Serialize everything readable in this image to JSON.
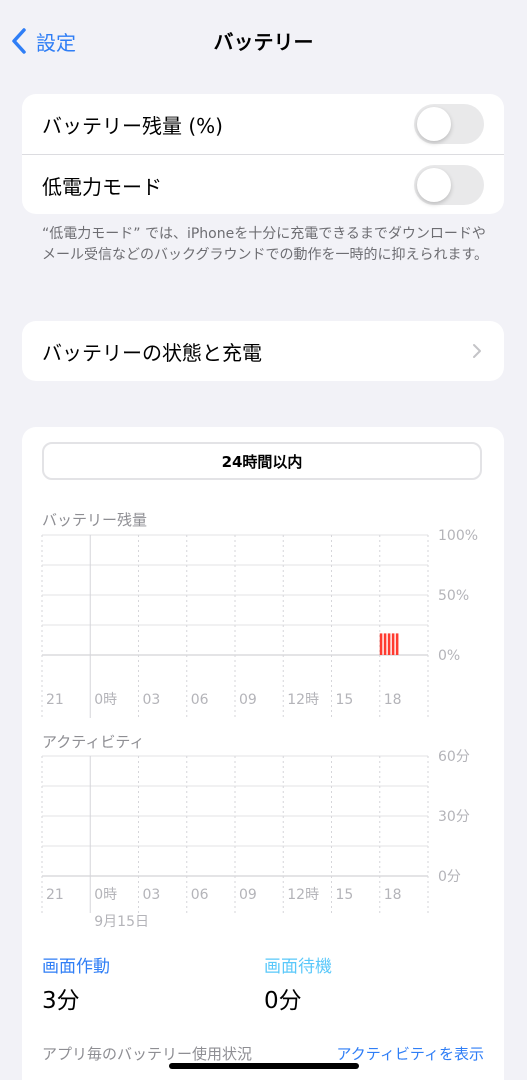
{
  "nav": {
    "back_label": "設定",
    "title": "バッテリー"
  },
  "toggles": [
    {
      "label": "バッテリー残量 (%)",
      "on": false
    },
    {
      "label": "低電力モード",
      "on": false
    }
  ],
  "low_power_note": "“低電力モード” では、iPhoneを十分に充電できるまでダウンロードやメール受信などのバックグラウンドでの動作を一時的に抑えられます。",
  "health_row": {
    "label": "バッテリーの状態と充電"
  },
  "usage": {
    "period_label": "24時間以内",
    "battery_section_label": "バッテリー残量",
    "activity_section_label": "アクティビティ",
    "date_label": "9月15日",
    "screen_on": {
      "label": "画面作動",
      "value": "3分",
      "color": "#2f7ef6"
    },
    "screen_off": {
      "label": "画面待機",
      "value": "0分",
      "color": "#5ac8fa"
    },
    "app_usage_header": "アプリ毎のバッテリー使用状況",
    "show_activity_link": "アクティビティを表示"
  },
  "chart_data": [
    {
      "type": "bar",
      "title": "バッテリー残量",
      "x_tick_labels": [
        "21",
        "0時",
        "03",
        "06",
        "09",
        "12時",
        "15",
        "18"
      ],
      "y_tick_labels": [
        "100%",
        "50%",
        "0%"
      ],
      "ylim": [
        0,
        100
      ],
      "series": [
        {
          "values": [
            18,
            18,
            18,
            18,
            18
          ],
          "color": "#ff3b30",
          "x_time_start_hour": 18.0,
          "x_time_step_hours": 0.25
        }
      ]
    },
    {
      "type": "bar",
      "title": "アクティビティ",
      "x_tick_labels": [
        "21",
        "0時",
        "03",
        "06",
        "09",
        "12時",
        "15",
        "18"
      ],
      "y_tick_labels": [
        "60分",
        "30分",
        "0分"
      ],
      "ylim": [
        0,
        60
      ],
      "series": []
    }
  ]
}
